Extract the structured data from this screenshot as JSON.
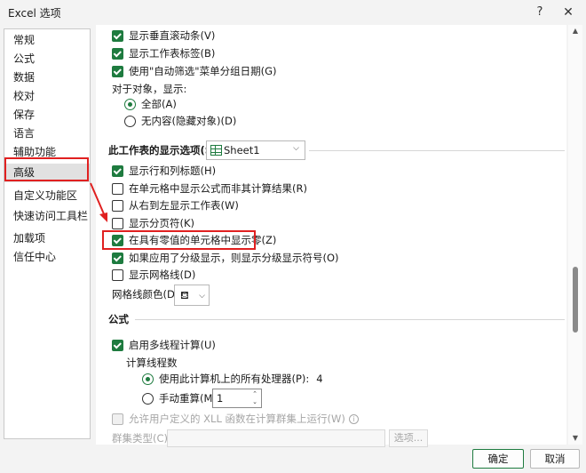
{
  "window": {
    "title": "Excel 选项",
    "help_label": "?",
    "close_label": "✕"
  },
  "sidebar": {
    "items": [
      {
        "label": "常规"
      },
      {
        "label": "公式"
      },
      {
        "label": "数据"
      },
      {
        "label": "校对"
      },
      {
        "label": "保存"
      },
      {
        "label": "语言"
      },
      {
        "label": "辅助功能"
      },
      {
        "label": "高级",
        "selected": true
      },
      {
        "label": "自定义功能区"
      },
      {
        "label": "快速访问工具栏"
      },
      {
        "label": "加载项"
      },
      {
        "label": "信任中心"
      }
    ]
  },
  "workbook_display": {
    "show_vscroll": {
      "label": "显示垂直滚动条(V)",
      "checked": true
    },
    "show_sheet_tabs": {
      "label": "显示工作表标签(B)",
      "checked": true
    },
    "group_dates": {
      "label": "使用\"自动筛选\"菜单分组日期(G)",
      "checked": true
    },
    "objects_label": "对于对象，显示:",
    "objects_all": {
      "label": "全部(A)",
      "checked": true
    },
    "objects_none": {
      "label": "无内容(隐藏对象)(D)",
      "checked": false
    }
  },
  "sheet_display": {
    "section_title": "此工作表的显示选项(S):",
    "sheet_select": "Sheet1",
    "show_headers": {
      "label": "显示行和列标题(H)",
      "checked": true
    },
    "show_formulas": {
      "label": "在单元格中显示公式而非其计算结果(R)",
      "checked": false
    },
    "right_to_left": {
      "label": "从右到左显示工作表(W)",
      "checked": false
    },
    "show_page_breaks": {
      "label": "显示分页符(K)",
      "checked": false
    },
    "show_zero": {
      "label": "在具有零值的单元格中显示零(Z)",
      "checked": true
    },
    "show_outline": {
      "label": "如果应用了分级显示，则显示分级显示符号(O)",
      "checked": true
    },
    "show_gridlines": {
      "label": "显示网格线(D)",
      "checked": false
    },
    "gridline_color_label": "网格线颜色(D)"
  },
  "formulas": {
    "section_title": "公式",
    "multithread": {
      "label": "启用多线程计算(U)",
      "checked": true
    },
    "threads_label": "计算线程数",
    "use_all_processors": {
      "label": "使用此计算机上的所有处理器(P):",
      "checked": true,
      "count": "4"
    },
    "manual": {
      "label": "手动重算(M)",
      "checked": false,
      "value": "1"
    },
    "allow_xll": {
      "label": "允许用户定义的 XLL 函数在计算群集上运行(W)"
    },
    "cluster_type_label": "群集类型(C):",
    "options_button": "选项..."
  },
  "footer": {
    "ok": "确定",
    "cancel": "取消"
  },
  "colors": {
    "accent": "#1e7b3f",
    "annotation": "#e02020"
  }
}
